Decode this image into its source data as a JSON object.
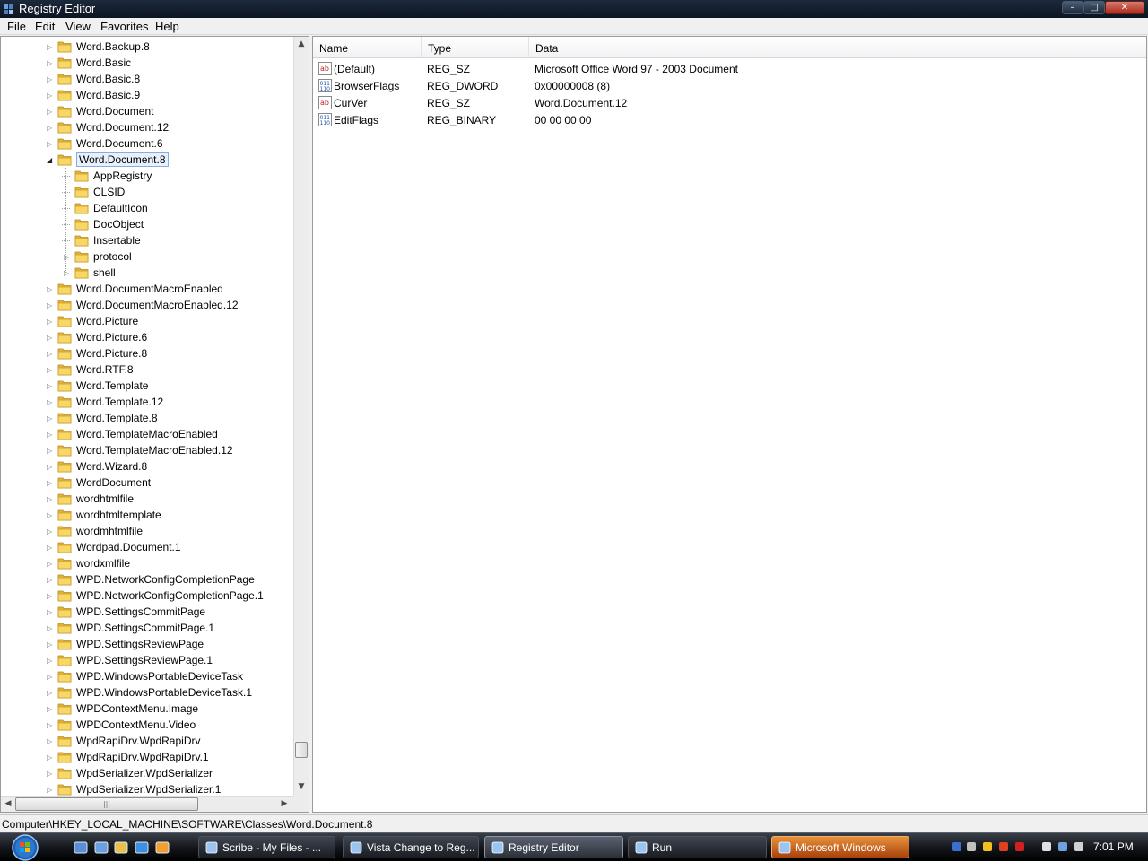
{
  "window": {
    "title": "Registry Editor",
    "min_glyph": "–",
    "max_glyph": "□",
    "close_glyph": "✕"
  },
  "menu": [
    "File",
    "Edit",
    "View",
    "Favorites",
    "Help"
  ],
  "tree": {
    "items": [
      {
        "label": "Word.Backup.8",
        "level": 0,
        "expander": "closed"
      },
      {
        "label": "Word.Basic",
        "level": 0,
        "expander": "closed"
      },
      {
        "label": "Word.Basic.8",
        "level": 0,
        "expander": "closed"
      },
      {
        "label": "Word.Basic.9",
        "level": 0,
        "expander": "closed"
      },
      {
        "label": "Word.Document",
        "level": 0,
        "expander": "closed"
      },
      {
        "label": "Word.Document.12",
        "level": 0,
        "expander": "closed"
      },
      {
        "label": "Word.Document.6",
        "level": 0,
        "expander": "closed"
      },
      {
        "label": "Word.Document.8",
        "level": 0,
        "expander": "open",
        "selected": true
      },
      {
        "label": "AppRegistry",
        "level": 1,
        "expander": "none"
      },
      {
        "label": "CLSID",
        "level": 1,
        "expander": "none"
      },
      {
        "label": "DefaultIcon",
        "level": 1,
        "expander": "none"
      },
      {
        "label": "DocObject",
        "level": 1,
        "expander": "none"
      },
      {
        "label": "Insertable",
        "level": 1,
        "expander": "none"
      },
      {
        "label": "protocol",
        "level": 1,
        "expander": "closed"
      },
      {
        "label": "shell",
        "level": 1,
        "expander": "closed"
      },
      {
        "label": "Word.DocumentMacroEnabled",
        "level": 0,
        "expander": "closed"
      },
      {
        "label": "Word.DocumentMacroEnabled.12",
        "level": 0,
        "expander": "closed"
      },
      {
        "label": "Word.Picture",
        "level": 0,
        "expander": "closed"
      },
      {
        "label": "Word.Picture.6",
        "level": 0,
        "expander": "closed"
      },
      {
        "label": "Word.Picture.8",
        "level": 0,
        "expander": "closed"
      },
      {
        "label": "Word.RTF.8",
        "level": 0,
        "expander": "closed"
      },
      {
        "label": "Word.Template",
        "level": 0,
        "expander": "closed"
      },
      {
        "label": "Word.Template.12",
        "level": 0,
        "expander": "closed"
      },
      {
        "label": "Word.Template.8",
        "level": 0,
        "expander": "closed"
      },
      {
        "label": "Word.TemplateMacroEnabled",
        "level": 0,
        "expander": "closed"
      },
      {
        "label": "Word.TemplateMacroEnabled.12",
        "level": 0,
        "expander": "closed"
      },
      {
        "label": "Word.Wizard.8",
        "level": 0,
        "expander": "closed"
      },
      {
        "label": "WordDocument",
        "level": 0,
        "expander": "closed"
      },
      {
        "label": "wordhtmlfile",
        "level": 0,
        "expander": "closed"
      },
      {
        "label": "wordhtmltemplate",
        "level": 0,
        "expander": "closed"
      },
      {
        "label": "wordmhtmlfile",
        "level": 0,
        "expander": "closed"
      },
      {
        "label": "Wordpad.Document.1",
        "level": 0,
        "expander": "closed"
      },
      {
        "label": "wordxmlfile",
        "level": 0,
        "expander": "closed"
      },
      {
        "label": "WPD.NetworkConfigCompletionPage",
        "level": 0,
        "expander": "closed"
      },
      {
        "label": "WPD.NetworkConfigCompletionPage.1",
        "level": 0,
        "expander": "closed"
      },
      {
        "label": "WPD.SettingsCommitPage",
        "level": 0,
        "expander": "closed"
      },
      {
        "label": "WPD.SettingsCommitPage.1",
        "level": 0,
        "expander": "closed"
      },
      {
        "label": "WPD.SettingsReviewPage",
        "level": 0,
        "expander": "closed"
      },
      {
        "label": "WPD.SettingsReviewPage.1",
        "level": 0,
        "expander": "closed"
      },
      {
        "label": "WPD.WindowsPortableDeviceTask",
        "level": 0,
        "expander": "closed"
      },
      {
        "label": "WPD.WindowsPortableDeviceTask.1",
        "level": 0,
        "expander": "closed"
      },
      {
        "label": "WPDContextMenu.Image",
        "level": 0,
        "expander": "closed"
      },
      {
        "label": "WPDContextMenu.Video",
        "level": 0,
        "expander": "closed"
      },
      {
        "label": "WpdRapiDrv.WpdRapiDrv",
        "level": 0,
        "expander": "closed"
      },
      {
        "label": "WpdRapiDrv.WpdRapiDrv.1",
        "level": 0,
        "expander": "closed"
      },
      {
        "label": "WpdSerializer.WpdSerializer",
        "level": 0,
        "expander": "closed"
      },
      {
        "label": "WpdSerializer.WpdSerializer.1",
        "level": 0,
        "expander": "closed"
      }
    ],
    "scroll_up_glyph": "▲",
    "scroll_down_glyph": "▼",
    "scroll_left_glyph": "◀",
    "scroll_right_glyph": "▶",
    "hthumb_grip": "|||",
    "vertical_scroll_position": 0.96,
    "horizontal_thumb_fraction": 0.65
  },
  "list": {
    "columns": [
      "Name",
      "Type",
      "Data"
    ],
    "rows": [
      {
        "icon": "string-value-icon",
        "name": "(Default)",
        "type": "REG_SZ",
        "data": "Microsoft Office Word 97 - 2003 Document"
      },
      {
        "icon": "binary-value-icon",
        "name": "BrowserFlags",
        "type": "REG_DWORD",
        "data": "0x00000008 (8)"
      },
      {
        "icon": "string-value-icon",
        "name": "CurVer",
        "type": "REG_SZ",
        "data": "Word.Document.12"
      },
      {
        "icon": "binary-value-icon",
        "name": "EditFlags",
        "type": "REG_BINARY",
        "data": "00 00 00 00"
      }
    ]
  },
  "status": {
    "path": "Computer\\HKEY_LOCAL_MACHINE\\SOFTWARE\\Classes\\Word.Document.8"
  },
  "taskbar": {
    "quick_launch": [
      "show-desktop-icon",
      "switch-windows-icon",
      "mail-icon",
      "internet-explorer-icon",
      "media-player-icon"
    ],
    "buttons": [
      {
        "icon": "internet-explorer-icon",
        "label": "Scribe - My Files - ...",
        "state": "normal"
      },
      {
        "icon": "document-icon",
        "label": "Vista Change to Reg...",
        "state": "normal"
      },
      {
        "icon": "registry-editor-icon",
        "label": "Registry Editor",
        "state": "active"
      },
      {
        "icon": "run-icon",
        "label": "Run",
        "state": "normal"
      },
      {
        "icon": "windows-dialog-icon",
        "label": "Microsoft Windows",
        "state": "flash"
      }
    ],
    "tray_icons": [
      "bluetooth-icon",
      "network-signal-icon",
      "color-tiles-icon",
      "windows-flag-icon",
      "antivirus-icon",
      "battery-icon",
      "network-connection-icon",
      "volume-icon"
    ],
    "clock": "7:01 PM"
  },
  "colors": {
    "selection_border": "#84acdd",
    "selection_fill": "#e7f0fc",
    "folder_yellow": "#f0c94a",
    "title_bar": "#0c1522"
  }
}
